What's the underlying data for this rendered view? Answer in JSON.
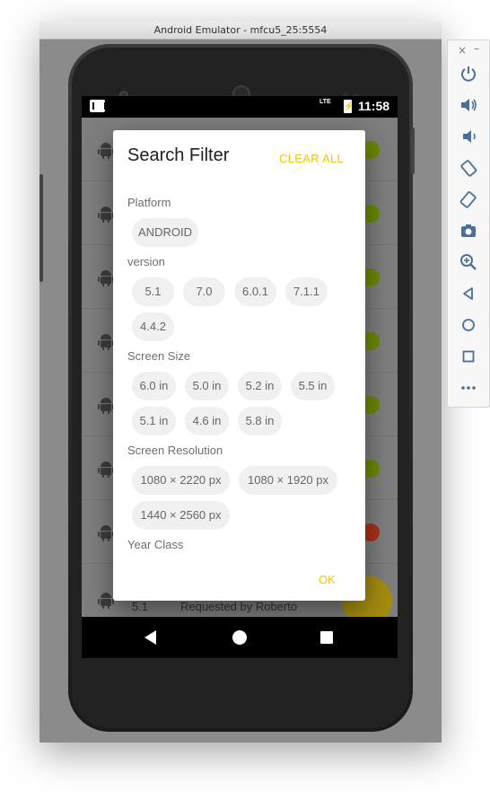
{
  "window": {
    "title": "Android Emulator - mfcu5_25:5554"
  },
  "status_bar": {
    "network": "LTE",
    "time": "11:58"
  },
  "background_list": {
    "visible_row_version": "5.1",
    "visible_row_requested": "Requested by Roberto",
    "dot_colors": [
      "#6b8a00",
      "#6b8a00",
      "#6b8a00",
      "#6b8a00",
      "#6b8a00",
      "#6b8a00",
      "#a8311a",
      "#a48c10"
    ]
  },
  "dialog": {
    "title": "Search Filter",
    "clear_all": "CLEAR ALL",
    "ok": "OK",
    "sections": {
      "platform": {
        "title": "Platform",
        "chips": [
          "ANDROID"
        ]
      },
      "version": {
        "title": "version",
        "chips": [
          "5.1",
          "7.0",
          "6.0.1",
          "7.1.1",
          "4.4.2"
        ]
      },
      "screen_size": {
        "title": "Screen Size",
        "chips": [
          "6.0 in",
          "5.0 in",
          "5.2 in",
          "5.5 in",
          "5.1 in",
          "4.6 in",
          "5.8 in"
        ]
      },
      "screen_resolution": {
        "title": "Screen Resolution",
        "chips": [
          "1080 × 2220 px",
          "1080 × 1920 px",
          "1440 × 2560 px"
        ]
      },
      "year_class": {
        "title": "Year Class"
      }
    }
  },
  "colors": {
    "accent": "#f4c20d",
    "chip_bg": "#f0f0f0",
    "chip_text": "#666666",
    "dim_overlay": "#7e7e7e"
  },
  "toolbar": {
    "icons": [
      "power-icon",
      "volume-up-icon",
      "volume-down-icon",
      "rotate-left-icon",
      "rotate-right-icon",
      "camera-icon",
      "zoom-icon",
      "back-icon",
      "home-icon",
      "overview-icon",
      "more-icon"
    ]
  }
}
